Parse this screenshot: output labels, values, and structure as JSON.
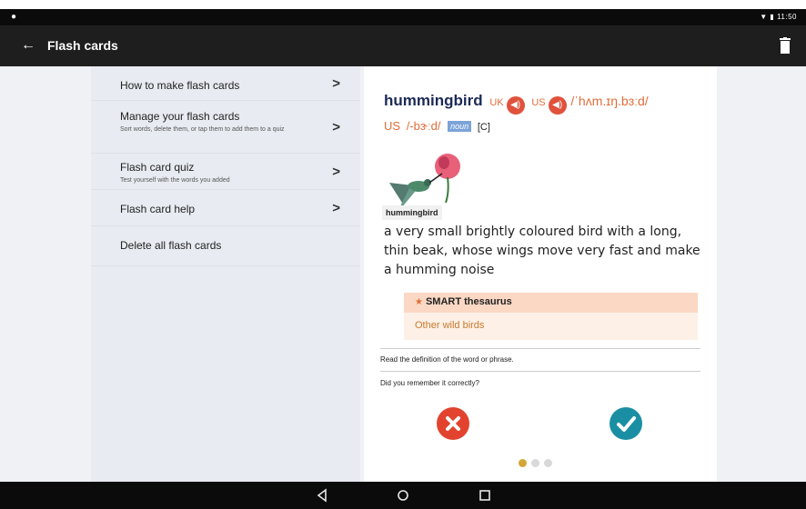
{
  "status_bar": {
    "time": "11:50",
    "left_icon": "notification-dot-icon",
    "right_icons": [
      "wifi-icon",
      "battery-icon"
    ]
  },
  "app_bar": {
    "title": "Flash cards",
    "back_icon": "back-arrow-icon",
    "action_icon": "trash-icon"
  },
  "menu": {
    "items": [
      {
        "title": "How to make flash cards",
        "subtitle": ""
      },
      {
        "title": "Manage your flash cards",
        "subtitle": "Sort words, delete them, or tap them to add them to a quiz"
      },
      {
        "title": "Flash card quiz",
        "subtitle": "Test yourself with the words you added"
      },
      {
        "title": "Flash card help",
        "subtitle": ""
      },
      {
        "title": "Delete all flash cards",
        "subtitle": ""
      }
    ]
  },
  "entry": {
    "headword": "hummingbird",
    "uk_label": "UK",
    "us_label": "US",
    "uk_ipa": "/ˈhʌm.ɪŋ.bɜːd/",
    "us_label_2": "US",
    "us_ipa": "/-bɝːd/",
    "pos": "noun",
    "grammar": "[C]",
    "picture_caption": "hummingbird",
    "definition": "a very small brightly coloured bird with a long, thin beak, whose wings move very fast and make a humming noise"
  },
  "thesaurus": {
    "header": "SMART thesaurus",
    "link": "Other wild birds"
  },
  "quiz": {
    "instruction": "Read the definition of the word or phrase.",
    "question": "Did you remember it correctly?",
    "wrong_icon": "cross-icon",
    "right_icon": "checkmark-icon",
    "page_count": 3,
    "active_page": 1
  },
  "colors": {
    "app_bar": "#1e1e1e",
    "accent_orange": "#e06d3a",
    "wrong_red": "#e2432e",
    "right_teal": "#1a8fa3",
    "active_dot": "#d4a537"
  }
}
